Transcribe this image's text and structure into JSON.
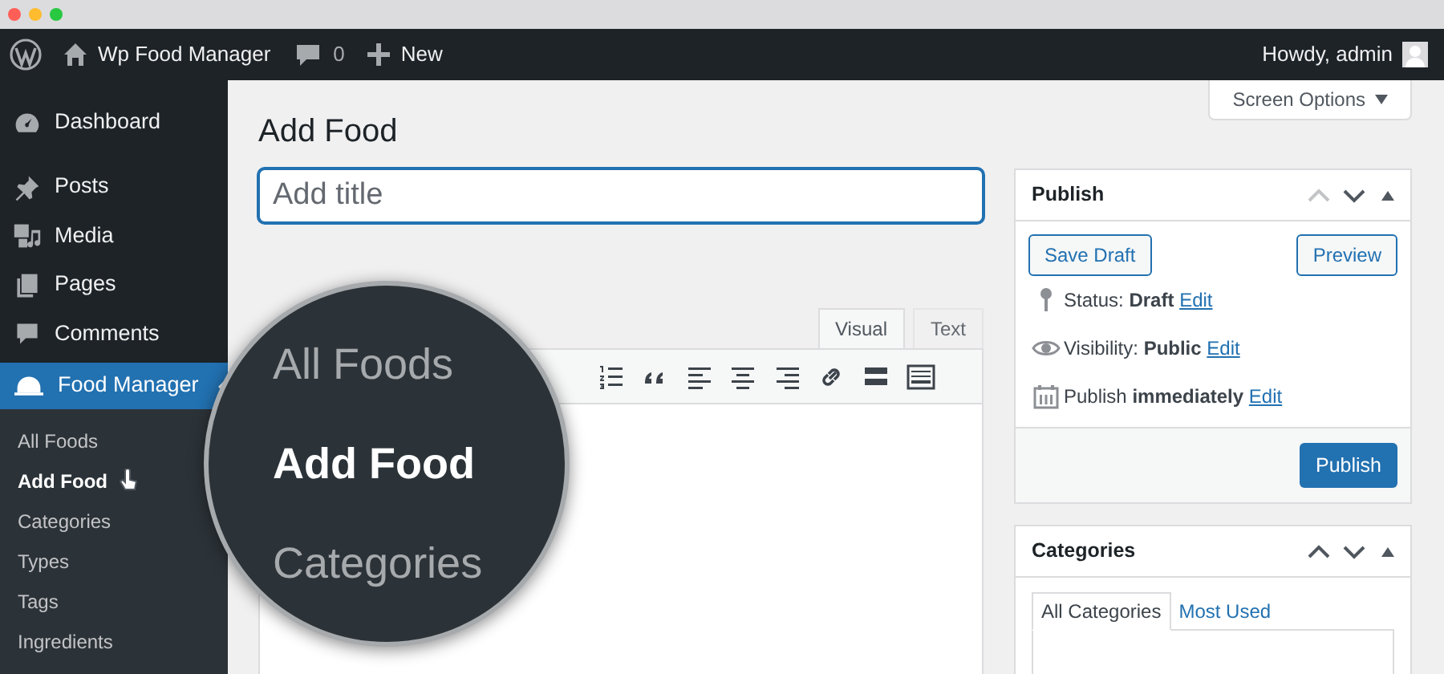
{
  "browser": {
    "controls": [
      {
        "color": "#ff5f57"
      },
      {
        "color": "#febc2e"
      },
      {
        "color": "#28c840"
      }
    ]
  },
  "admin_bar": {
    "site": "Wp Food Manager",
    "comments": "0",
    "new": "New",
    "greeting": "Howdy, admin"
  },
  "sidebar": {
    "items": [
      {
        "label": "Dashboard",
        "selected": false
      },
      {
        "label": "Posts",
        "selected": false
      },
      {
        "label": "Media",
        "selected": false
      },
      {
        "label": "Pages",
        "selected": false
      },
      {
        "label": "Comments",
        "selected": false
      },
      {
        "label": "Food Manager",
        "selected": true
      }
    ],
    "submenu": [
      {
        "label": "All Foods",
        "selected": false
      },
      {
        "label": "Add Food",
        "selected": true
      },
      {
        "label": "Categories",
        "selected": false
      },
      {
        "label": "Types",
        "selected": false
      },
      {
        "label": "Tags",
        "selected": false
      },
      {
        "label": "Ingredients",
        "selected": false
      }
    ]
  },
  "page": {
    "title": "Add Food",
    "screen_options": "Screen Options",
    "title_field": {
      "placeholder": "Add title"
    }
  },
  "editor": {
    "tabs": [
      {
        "label": "Visual",
        "selected": true
      },
      {
        "label": "Text",
        "selected": false
      }
    ]
  },
  "magnifier": {
    "items": [
      {
        "label": "All Foods",
        "selected": false
      },
      {
        "label": "Add Food",
        "selected": true
      },
      {
        "label": "Categories",
        "selected": false
      }
    ]
  },
  "publish": {
    "title": "Publish",
    "save_draft": "Save Draft",
    "preview": "Preview",
    "rows": [
      {
        "label": "Status:",
        "value": "Draft",
        "link": "Edit"
      },
      {
        "label": "Visibility:",
        "value": "Public",
        "link": "Edit"
      },
      {
        "label": "Publish",
        "value": "immediately",
        "link": "Edit"
      }
    ],
    "publish_button": "Publish"
  },
  "categories": {
    "title": "Categories",
    "tabs": [
      {
        "label": "All Categories",
        "selected": true
      },
      {
        "label": "Most Used",
        "selected": false
      }
    ]
  }
}
